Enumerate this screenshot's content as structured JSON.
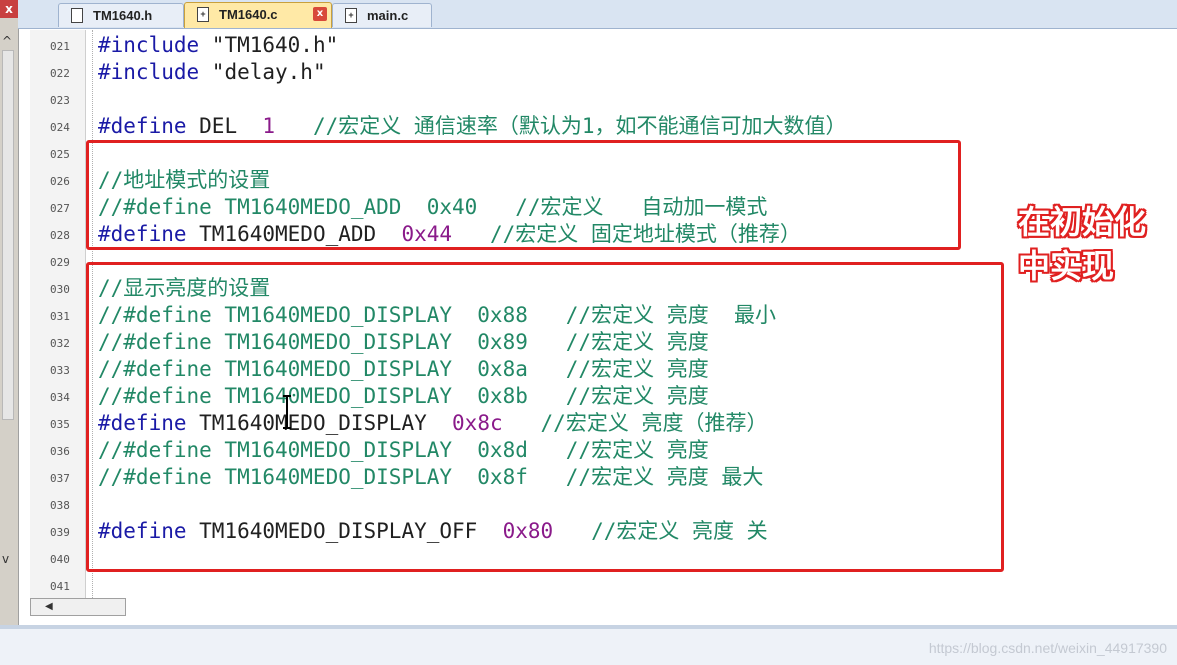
{
  "tabs": [
    {
      "label": "TM1640.h",
      "active": false
    },
    {
      "label": "TM1640.c",
      "active": true
    },
    {
      "label": "main.c",
      "active": false
    }
  ],
  "lines": [
    {
      "num": "021",
      "parts": [
        [
          "kw",
          "#include"
        ],
        [
          "str",
          " \"TM1640.h\""
        ]
      ]
    },
    {
      "num": "022",
      "parts": [
        [
          "kw",
          "#include"
        ],
        [
          "str",
          " \"delay.h\""
        ]
      ]
    },
    {
      "num": "023",
      "parts": []
    },
    {
      "num": "024",
      "parts": [
        [
          "kw",
          "#define"
        ],
        [
          "str",
          " DEL  "
        ],
        [
          "num",
          "1"
        ],
        [
          "cm",
          "   //宏定义 通信速率（默认为1，如不能通信可加大数值）"
        ]
      ]
    },
    {
      "num": "025",
      "parts": []
    },
    {
      "num": "026",
      "parts": [
        [
          "cm",
          "//地址模式的设置"
        ]
      ]
    },
    {
      "num": "027",
      "parts": [
        [
          "cm",
          "//#define TM1640MEDO_ADD  0x40   //宏定义   自动加一模式"
        ]
      ]
    },
    {
      "num": "028",
      "parts": [
        [
          "kw",
          "#define"
        ],
        [
          "str",
          " TM1640MEDO_ADD  "
        ],
        [
          "num",
          "0x44"
        ],
        [
          "cm",
          "   //宏定义 固定地址模式（推荐）"
        ]
      ]
    },
    {
      "num": "029",
      "parts": []
    },
    {
      "num": "030",
      "parts": [
        [
          "cm",
          "//显示亮度的设置"
        ]
      ]
    },
    {
      "num": "031",
      "parts": [
        [
          "cm",
          "//#define TM1640MEDO_DISPLAY  0x88   //宏定义 亮度  最小"
        ]
      ]
    },
    {
      "num": "032",
      "parts": [
        [
          "cm",
          "//#define TM1640MEDO_DISPLAY  0x89   //宏定义 亮度"
        ]
      ]
    },
    {
      "num": "033",
      "parts": [
        [
          "cm",
          "//#define TM1640MEDO_DISPLAY  0x8a   //宏定义 亮度"
        ]
      ]
    },
    {
      "num": "034",
      "parts": [
        [
          "cm",
          "//#define TM1640MEDO_DISPLAY  0x8b   //宏定义 亮度"
        ]
      ]
    },
    {
      "num": "035",
      "parts": [
        [
          "kw",
          "#define"
        ],
        [
          "str",
          " TM1640MEDO_DISPLAY  "
        ],
        [
          "num",
          "0x8c"
        ],
        [
          "cm",
          "   //宏定义 亮度（推荐）"
        ]
      ]
    },
    {
      "num": "036",
      "parts": [
        [
          "cm",
          "//#define TM1640MEDO_DISPLAY  0x8d   //宏定义 亮度"
        ]
      ]
    },
    {
      "num": "037",
      "parts": [
        [
          "cm",
          "//#define TM1640MEDO_DISPLAY  0x8f   //宏定义 亮度 最大"
        ]
      ]
    },
    {
      "num": "038",
      "parts": []
    },
    {
      "num": "039",
      "parts": [
        [
          "kw",
          "#define"
        ],
        [
          "str",
          " TM1640MEDO_DISPLAY_OFF  "
        ],
        [
          "num",
          "0x80"
        ],
        [
          "cm",
          "   //宏定义 亮度 关"
        ]
      ]
    },
    {
      "num": "040",
      "parts": []
    },
    {
      "num": "041",
      "parts": []
    }
  ],
  "annotation": {
    "text": "在初始化中实现"
  },
  "watermark": "https://blog.csdn.net/weixin_44917390",
  "colors": {
    "highlight": "#e02020",
    "keyword": "#1a1aa6",
    "comment": "#228866",
    "number": "#8a1a8a"
  },
  "icons": {
    "file_tab": "document-icon",
    "close_tab": "close-icon"
  }
}
